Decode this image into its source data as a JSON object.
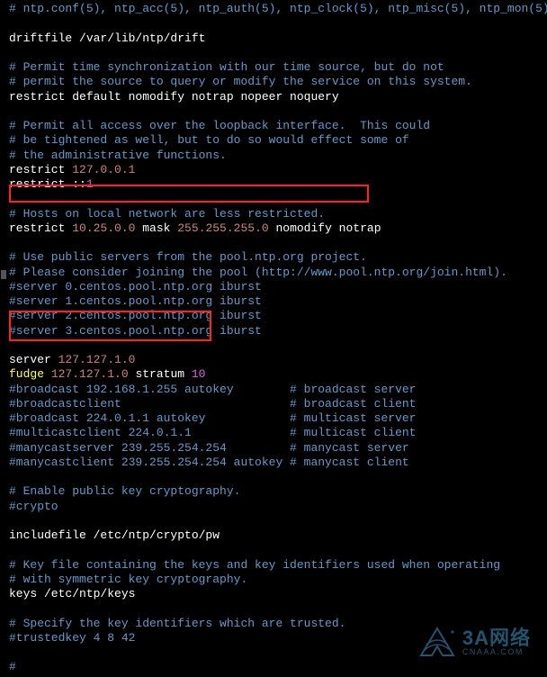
{
  "lines": [
    [
      [
        "cmt",
        "# ntp.conf(5), ntp_acc(5), ntp_auth(5), ntp_clock(5), ntp_misc(5), ntp_mon(5)"
      ]
    ],
    [
      [
        "txt",
        ""
      ]
    ],
    [
      [
        "txt",
        "driftfile /var/lib/ntp/drift"
      ]
    ],
    [
      [
        "txt",
        ""
      ]
    ],
    [
      [
        "cmt",
        "# Permit time synchronization with our time source, but do not"
      ]
    ],
    [
      [
        "cmt",
        "# permit the source to query or modify the service on this system."
      ]
    ],
    [
      [
        "txt",
        "restrict default nomodify notrap nopeer noquery"
      ]
    ],
    [
      [
        "txt",
        ""
      ]
    ],
    [
      [
        "cmt",
        "# Permit all access over the loopback interface.  This could"
      ]
    ],
    [
      [
        "cmt",
        "# be tightened as well, but to do so would effect some of"
      ]
    ],
    [
      [
        "cmt",
        "# the administrative functions."
      ]
    ],
    [
      [
        "txt",
        "restrict "
      ],
      [
        "val",
        "127.0.0.1"
      ]
    ],
    [
      [
        "txt",
        "restrict ::"
      ],
      [
        "num",
        "1"
      ]
    ],
    [
      [
        "txt",
        ""
      ]
    ],
    [
      [
        "cmt",
        "# Hosts on local network are less restricted."
      ]
    ],
    [
      [
        "txt",
        "restrict "
      ],
      [
        "val",
        "10.25.0.0"
      ],
      [
        "txt",
        " mask "
      ],
      [
        "val",
        "255.255.255.0"
      ],
      [
        "txt",
        " nomodify notrap"
      ]
    ],
    [
      [
        "txt",
        ""
      ]
    ],
    [
      [
        "cmt",
        "# Use public servers from the pool.ntp.org project."
      ]
    ],
    [
      [
        "cmt",
        "# Please consider joining the pool (http://www.pool.ntp.org/join.html)."
      ]
    ],
    [
      [
        "cmt",
        "#server 0.centos.pool.ntp.org iburst"
      ]
    ],
    [
      [
        "cmt",
        "#server 1.centos.pool.ntp.org iburst"
      ]
    ],
    [
      [
        "cmt",
        "#server 2.centos.pool.ntp.org iburst"
      ]
    ],
    [
      [
        "cmt",
        "#server 3.centos.pool.ntp.org iburst"
      ]
    ],
    [
      [
        "txt",
        ""
      ]
    ],
    [
      [
        "txt",
        "server "
      ],
      [
        "val",
        "127.127.1.0"
      ]
    ],
    [
      [
        "kw",
        "fudge"
      ],
      [
        "txt",
        " "
      ],
      [
        "val",
        "127.127.1.0"
      ],
      [
        "txt",
        " stratum "
      ],
      [
        "num",
        "10"
      ]
    ],
    [
      [
        "cmt",
        "#broadcast 192.168.1.255 autokey        # broadcast server"
      ]
    ],
    [
      [
        "cmt",
        "#broadcastclient                        # broadcast client"
      ]
    ],
    [
      [
        "cmt",
        "#broadcast 224.0.1.1 autokey            # multicast server"
      ]
    ],
    [
      [
        "cmt",
        "#multicastclient 224.0.1.1              # multicast client"
      ]
    ],
    [
      [
        "cmt",
        "#manycastserver 239.255.254.254         # manycast server"
      ]
    ],
    [
      [
        "cmt",
        "#manycastclient 239.255.254.254 autokey # manycast client"
      ]
    ],
    [
      [
        "txt",
        ""
      ]
    ],
    [
      [
        "cmt",
        "# Enable public key cryptography."
      ]
    ],
    [
      [
        "cmt",
        "#crypto"
      ]
    ],
    [
      [
        "txt",
        ""
      ]
    ],
    [
      [
        "txt",
        "includefile /etc/ntp/crypto/pw"
      ]
    ],
    [
      [
        "txt",
        ""
      ]
    ],
    [
      [
        "cmt",
        "# Key file containing the keys and key identifiers used when operating"
      ]
    ],
    [
      [
        "cmt",
        "# with symmetric key cryptography."
      ]
    ],
    [
      [
        "txt",
        "keys /etc/ntp/keys"
      ]
    ],
    [
      [
        "txt",
        ""
      ]
    ],
    [
      [
        "cmt",
        "# Specify the key identifiers which are trusted."
      ]
    ],
    [
      [
        "cmt",
        "#trustedkey 4 8 42"
      ]
    ],
    [
      [
        "txt",
        ""
      ]
    ],
    [
      [
        "cmt",
        "#                                                                        "
      ]
    ]
  ],
  "watermark": {
    "main": "3A网络",
    "sub": "CNAAA.COM"
  }
}
